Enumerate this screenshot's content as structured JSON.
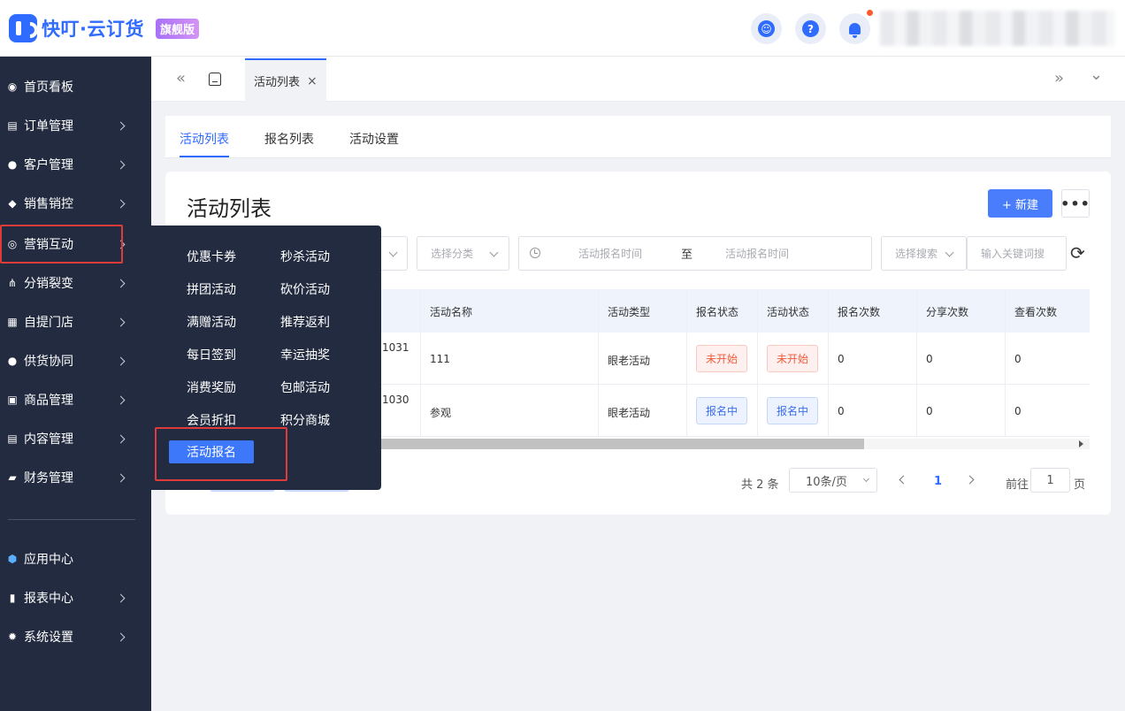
{
  "app": {
    "title": "快叮·云订货",
    "badge": "旗舰版",
    "accent": "#2f6bff"
  },
  "header": {
    "icons": [
      "support-icon",
      "help-icon",
      "bell-icon"
    ],
    "help_glyph": "?"
  },
  "sidebar": {
    "items": [
      {
        "label": "首页看板",
        "icon": "dashboard-icon",
        "glyph": "◉",
        "has_arrow": false
      },
      {
        "label": "订单管理",
        "icon": "order-icon",
        "glyph": "▤",
        "has_arrow": true
      },
      {
        "label": "客户管理",
        "icon": "customer-icon",
        "glyph": "●",
        "has_arrow": true
      },
      {
        "label": "销售销控",
        "icon": "tag-icon",
        "glyph": "◆",
        "has_arrow": true
      },
      {
        "label": "营销互动",
        "icon": "marketing-icon",
        "glyph": "◎",
        "has_arrow": true
      },
      {
        "label": "分销裂变",
        "icon": "distribution-icon",
        "glyph": "⋔",
        "has_arrow": true
      },
      {
        "label": "自提门店",
        "icon": "store-icon",
        "glyph": "▦",
        "has_arrow": true
      },
      {
        "label": "供货协同",
        "icon": "supply-icon",
        "glyph": "●",
        "has_arrow": true
      },
      {
        "label": "商品管理",
        "icon": "goods-icon",
        "glyph": "▣",
        "has_arrow": true
      },
      {
        "label": "内容管理",
        "icon": "content-icon",
        "glyph": "▤",
        "has_arrow": true
      },
      {
        "label": "财务管理",
        "icon": "finance-icon",
        "glyph": "▰",
        "has_arrow": true
      }
    ],
    "bottom_items": [
      {
        "label": "应用中心",
        "icon": "app-center-icon",
        "glyph": "⬢",
        "has_arrow": false
      },
      {
        "label": "报表中心",
        "icon": "report-icon",
        "glyph": "▮",
        "has_arrow": true
      },
      {
        "label": "系统设置",
        "icon": "settings-icon",
        "glyph": "✹",
        "has_arrow": true
      }
    ]
  },
  "tabbar": {
    "collapse_glyph": "«",
    "expand_glyph": "»",
    "menu_glyph": "⌄",
    "active_tab": "活动列表",
    "close_glyph": "×"
  },
  "subtabs": [
    "活动列表",
    "报名列表",
    "活动设置"
  ],
  "card": {
    "title": "活动列表",
    "new_button": "+ 新建",
    "more_button": "•••"
  },
  "filters": {
    "category_placeholder": "选择分类",
    "date_start": "活动报名时间",
    "date_sep": "至",
    "date_end": "活动报名时间",
    "search_type": "选择搜索",
    "keyword_placeholder": "输入关键词搜",
    "refresh_glyph": "⟳"
  },
  "table": {
    "columns": [
      "活动名称",
      "活动类型",
      "报名状态",
      "活动状态",
      "报名次数",
      "分享次数",
      "查看次数"
    ],
    "rows": [
      {
        "id_tail": "1031",
        "name": "111",
        "type": "眼老活动",
        "signup_status": "未开始",
        "activity_status": "未开始",
        "signups": "0",
        "shares": "0",
        "views": "0",
        "status_color": "red"
      },
      {
        "id_tail": "1030",
        "name": "参观",
        "type": "眼老活动",
        "signup_status": "报名中",
        "activity_status": "报名中",
        "signups": "0",
        "shares": "0",
        "views": "0",
        "status_color": "blue"
      }
    ]
  },
  "pagination": {
    "total": "共 2 条",
    "page_size": "10条/页",
    "current_page": "1",
    "goto_label": "前往",
    "goto_value": "1",
    "page_suffix": "页"
  },
  "flyout": {
    "items": [
      "优惠卡券",
      "秒杀活动",
      "拼团活动",
      "砍价活动",
      "满赠活动",
      "推荐返利",
      "每日签到",
      "幸运抽奖",
      "消费奖励",
      "包邮活动",
      "会员折扣",
      "积分商城"
    ],
    "active": "活动报名"
  }
}
